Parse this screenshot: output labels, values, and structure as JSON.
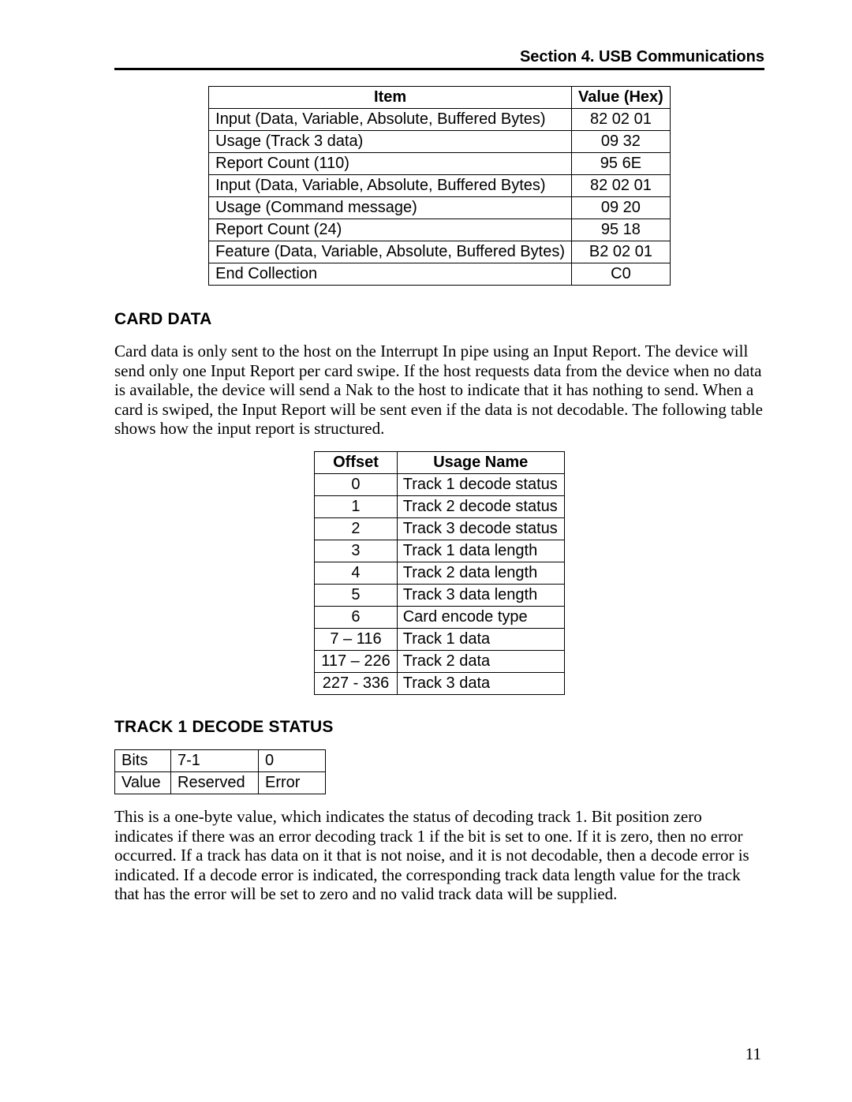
{
  "header": {
    "text": "Section 4.  USB Communications"
  },
  "table1": {
    "headers": {
      "item": "Item",
      "value": "Value (Hex)"
    },
    "rows": [
      {
        "item": "Input (Data, Variable, Absolute, Buffered Bytes)",
        "value": "82 02 01"
      },
      {
        "item": "Usage (Track 3 data)",
        "value": "09 32"
      },
      {
        "item": "Report Count (110)",
        "value": "95 6E"
      },
      {
        "item": "Input (Data, Variable, Absolute, Buffered Bytes)",
        "value": "82 02 01"
      },
      {
        "item": "Usage (Command message)",
        "value": "09 20"
      },
      {
        "item": "Report Count (24)",
        "value": "95 18"
      },
      {
        "item": "Feature (Data, Variable, Absolute, Buffered Bytes)",
        "value": "B2 02 01"
      },
      {
        "item": "End Collection",
        "value": "C0"
      }
    ]
  },
  "cardData": {
    "heading": "CARD DATA",
    "paragraph": "Card data is only sent to the host on the Interrupt In pipe using an Input Report.  The device will send only one Input Report per card swipe.  If the host requests data from the device when no data is available, the device will send a Nak to the host to indicate that it has nothing to send.  When a card is swiped, the Input Report will be sent even if the data is not decodable.  The following table shows how the input report is structured."
  },
  "table2": {
    "headers": {
      "offset": "Offset",
      "usage": "Usage Name"
    },
    "rows": [
      {
        "offset": "0",
        "usage": "Track 1 decode status"
      },
      {
        "offset": "1",
        "usage": "Track 2 decode status"
      },
      {
        "offset": "2",
        "usage": "Track 3 decode status"
      },
      {
        "offset": "3",
        "usage": "Track 1 data length"
      },
      {
        "offset": "4",
        "usage": "Track 2 data length"
      },
      {
        "offset": "5",
        "usage": "Track 3 data length"
      },
      {
        "offset": "6",
        "usage": "Card encode type"
      },
      {
        "offset": "7 – 116",
        "usage": "Track 1 data"
      },
      {
        "offset": "117 – 226",
        "usage": "Track 2 data"
      },
      {
        "offset": "227 - 336",
        "usage": "Track 3 data"
      }
    ]
  },
  "track1": {
    "heading": "TRACK 1 DECODE STATUS",
    "table": {
      "r1": {
        "c1": "Bits",
        "c2": "7-1",
        "c3": "0"
      },
      "r2": {
        "c1": "Value",
        "c2": "Reserved",
        "c3": "Error"
      }
    },
    "paragraph": "This is a one-byte value, which indicates the status of decoding track 1.  Bit position zero indicates if there was an error decoding track 1 if the bit is set to one.  If it is zero, then no error occurred.  If a track has data on it that is not noise, and it is not decodable, then a decode error is indicated.  If a decode error is indicated, the corresponding track data length value for the track that has the error will be set to zero and no valid track data will be supplied."
  },
  "pageNumber": "11"
}
